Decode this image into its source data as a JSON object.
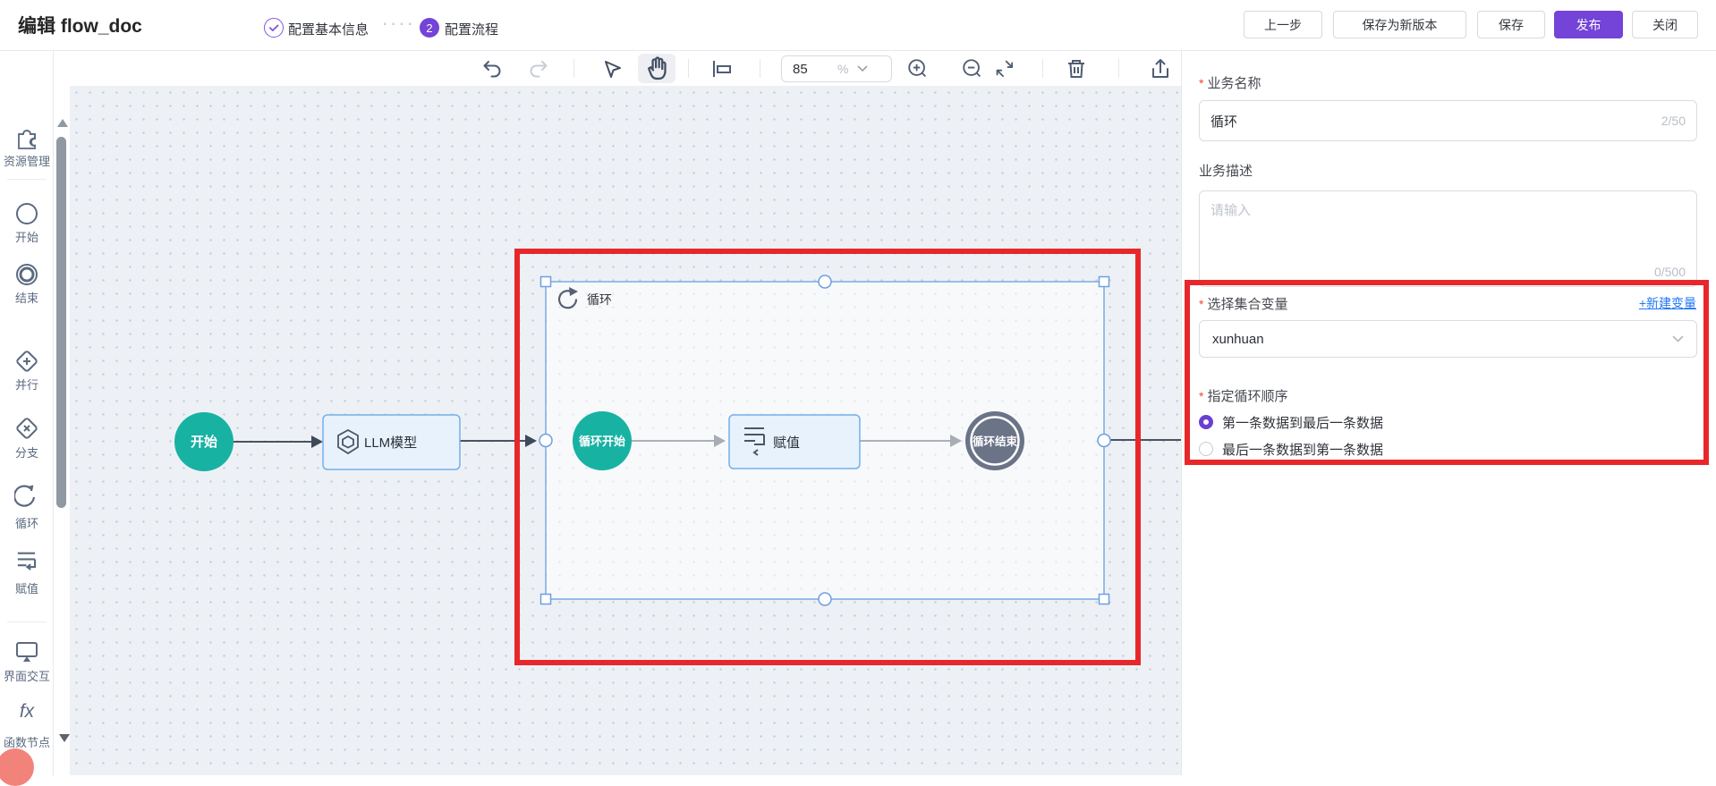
{
  "header": {
    "title": "编辑 flow_doc",
    "step_separator": "····",
    "steps": [
      {
        "label": "配置基本信息",
        "state": "done"
      },
      {
        "num": "2",
        "label": "配置流程",
        "state": "active"
      }
    ],
    "buttons": {
      "prev": "上一步",
      "save_new": "保存为新版本",
      "save": "保存",
      "publish": "发布",
      "close": "关闭"
    }
  },
  "toolbar": {
    "zoom_value": "85",
    "zoom_unit": "%"
  },
  "sidebar": {
    "fx_glyph": "fx",
    "items": [
      {
        "label": "资源管理"
      },
      {
        "label": "开始"
      },
      {
        "label": "结束"
      },
      {
        "label": "并行"
      },
      {
        "label": "分支"
      },
      {
        "label": "循环"
      },
      {
        "label": "赋值"
      },
      {
        "label": "界面交互"
      },
      {
        "label": "函数节点"
      }
    ]
  },
  "canvas": {
    "nodes": {
      "start": "开始",
      "llm": "LLM模型",
      "loop": "循环",
      "loop_start": "循环开始",
      "assign": "赋值",
      "loop_end": "循环结束"
    }
  },
  "panel": {
    "required_mark": "*",
    "name_label": "业务名称",
    "name_value": "循环",
    "name_count": "2/50",
    "desc_label": "业务描述",
    "desc_placeholder": "请输入",
    "desc_count": "0/500",
    "collection_label": "选择集合变量",
    "new_var_link": "+新建变量",
    "collection_value": "xunhuan",
    "order_label": "指定循环顺序",
    "order_options": [
      {
        "label": "第一条数据到最后一条数据",
        "selected": true
      },
      {
        "label": "最后一条数据到第一条数据",
        "selected": false
      }
    ]
  },
  "colors": {
    "accent_purple": "#7443d8",
    "teal_node": "#18b2a3",
    "annotation_red": "#e8272b",
    "link_blue": "#2077f4",
    "node_fill": "#e7f2fd",
    "node_border": "#74b0ea",
    "loop_end_gray": "#6b7487",
    "selection_blue": "#79abe4"
  }
}
